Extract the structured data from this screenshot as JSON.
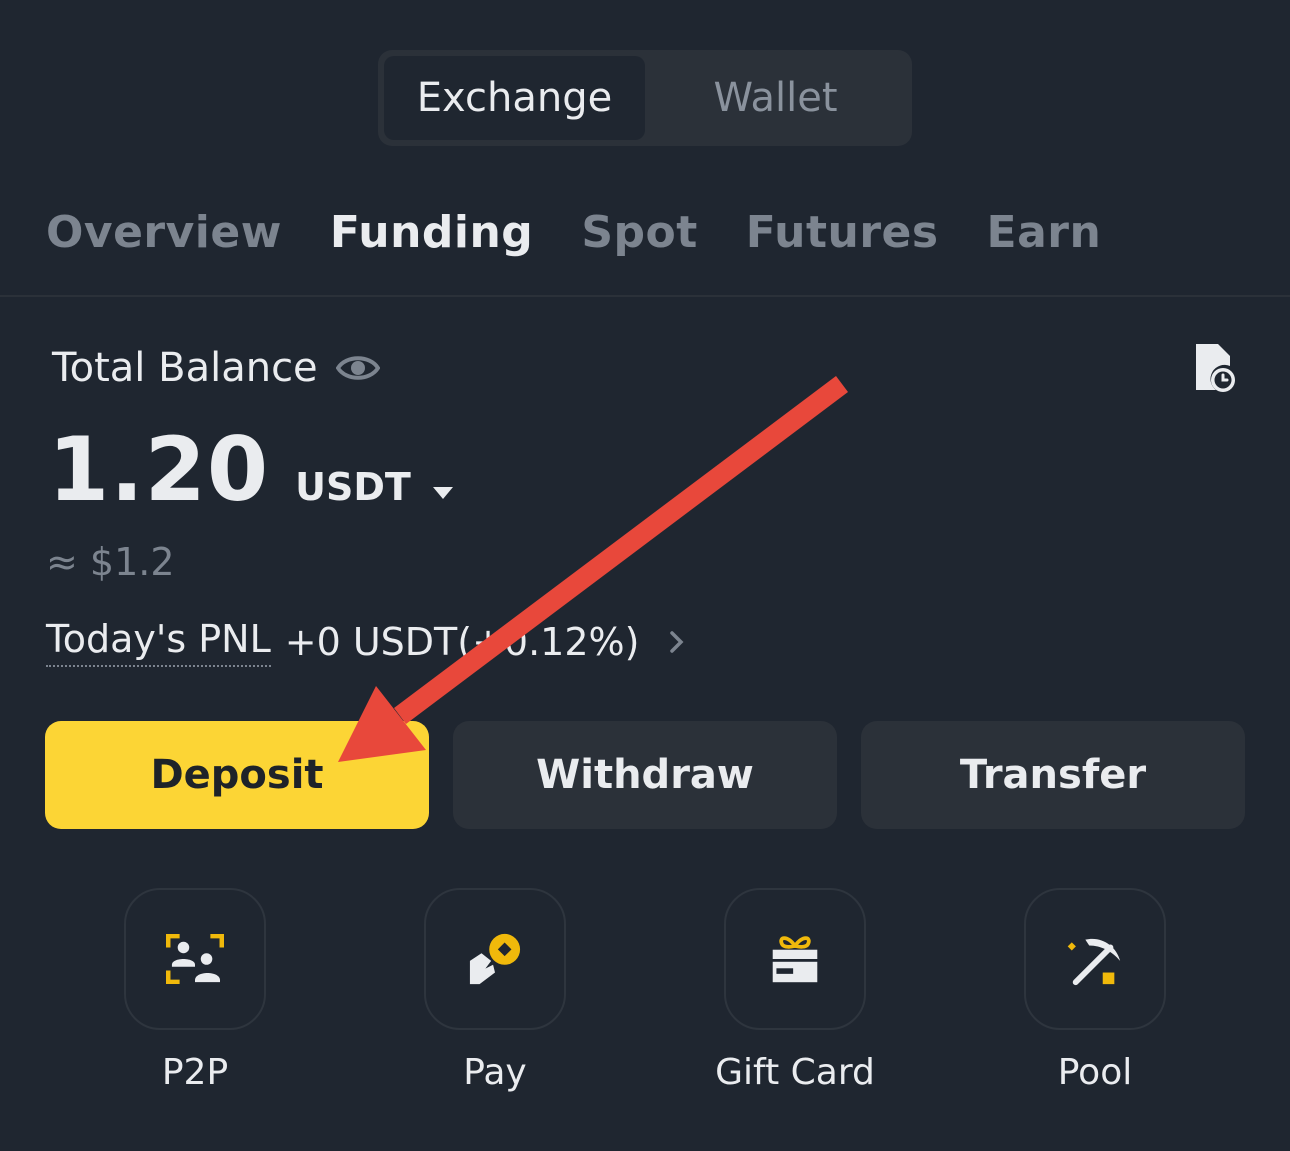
{
  "segmented": {
    "exchange_label": "Exchange",
    "wallet_label": "Wallet",
    "selected": "Exchange"
  },
  "tabs": [
    {
      "label": "Overview",
      "active": false
    },
    {
      "label": "Funding",
      "active": true
    },
    {
      "label": "Spot",
      "active": false
    },
    {
      "label": "Futures",
      "active": false
    },
    {
      "label": "Earn",
      "active": false
    }
  ],
  "balance": {
    "label": "Total Balance",
    "amount": "1.20",
    "unit": "USDT",
    "fiat": "≈ $1.2",
    "pnl_label": "Today's PNL",
    "pnl_value": "+0 USDT(+0.12%)"
  },
  "actions": {
    "deposit": "Deposit",
    "withdraw": "Withdraw",
    "transfer": "Transfer"
  },
  "shortcuts": [
    {
      "label": "P2P",
      "icon": "p2p-icon"
    },
    {
      "label": "Pay",
      "icon": "pay-icon"
    },
    {
      "label": "Gift Card",
      "icon": "gift-card-icon"
    },
    {
      "label": "Pool",
      "icon": "pool-icon"
    }
  ],
  "colors": {
    "background": "#1f2630",
    "accent": "#fcd535",
    "annotation_arrow": "#e8483b",
    "muted_text": "#7c848f"
  }
}
